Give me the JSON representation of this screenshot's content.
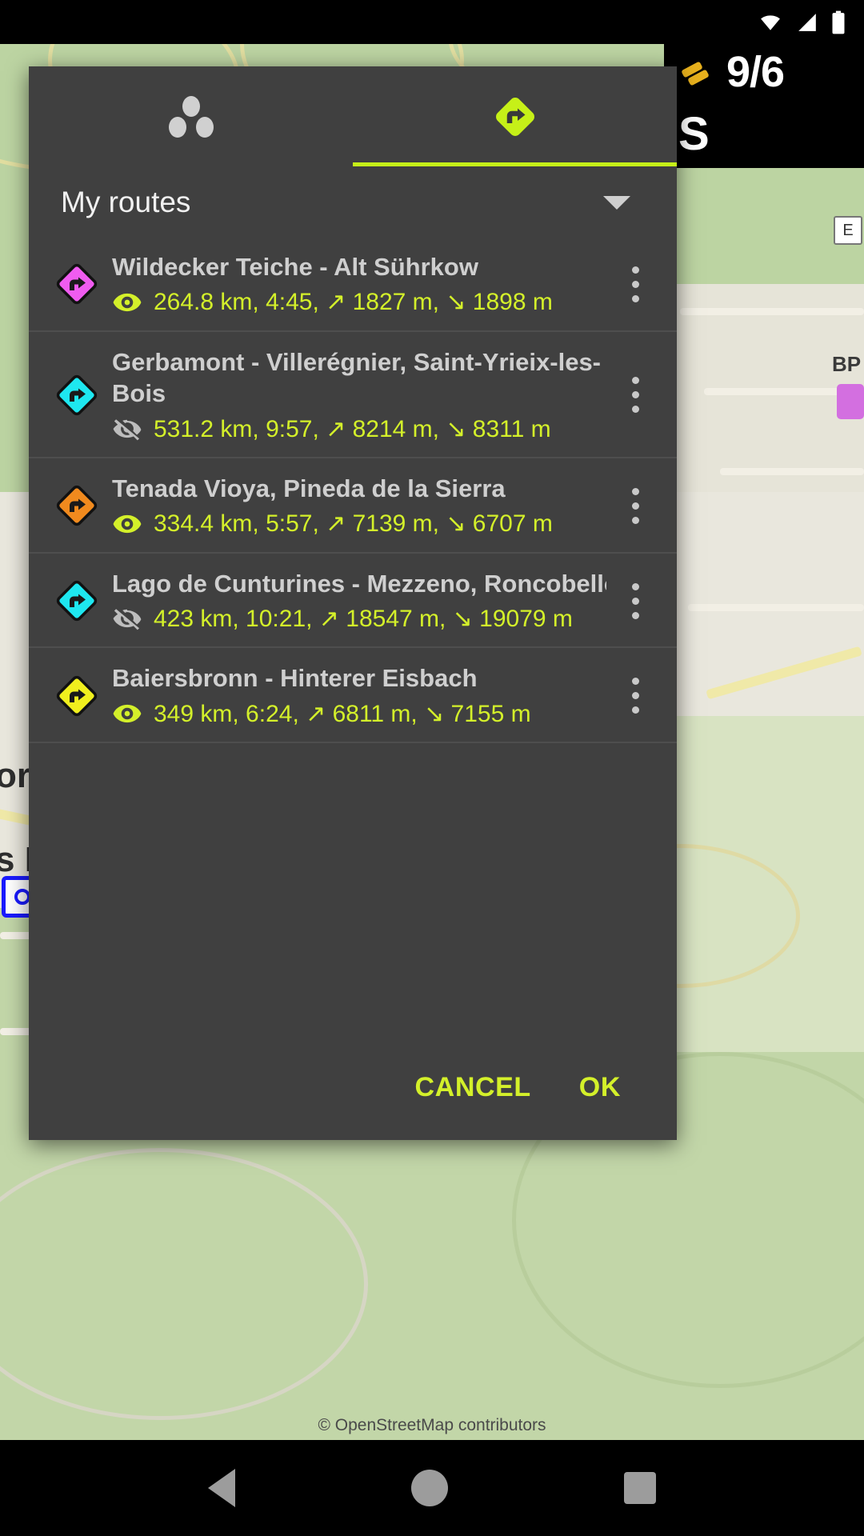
{
  "statusbar": {
    "icons": [
      "wifi-icon",
      "signal-icon",
      "battery-icon"
    ]
  },
  "map": {
    "attribution": "© OpenStreetMap contributors",
    "hud_counter": "9/6",
    "labels": [
      "S",
      "E",
      "BP",
      "or",
      "s E"
    ]
  },
  "dialog": {
    "tabs": [
      {
        "name": "points-tab",
        "icon": "three-dots-cluster-icon",
        "active": false
      },
      {
        "name": "routes-tab",
        "icon": "route-turn-right-diamond-icon",
        "active": true
      }
    ],
    "accent_color": "#c6f018",
    "section": {
      "title": "My routes",
      "expander_icon": "chevron-down-icon"
    },
    "routes": [
      {
        "name": "Wildecker Teiche - Alt Sührkow",
        "marker_color": "#f05cf0",
        "visible": true,
        "visibility_icon": "eye-icon",
        "stats": "264.8 km, 4:45, ↗ 1827 m, ↘ 1898 m",
        "distance": "264.8 km",
        "duration": "4:45",
        "ascent": "1827 m",
        "descent": "1898 m",
        "menu_icon": "kebab-menu-icon"
      },
      {
        "name": "Gerbamont - Villerégnier, Saint-Yrieix-les-Bois",
        "marker_color": "#1ee7f0",
        "visible": false,
        "visibility_icon": "eye-off-icon",
        "stats": "531.2 km, 9:57, ↗ 8214 m, ↘ 8311 m",
        "distance": "531.2 km",
        "duration": "9:57",
        "ascent": "8214 m",
        "descent": "8311 m",
        "menu_icon": "kebab-menu-icon"
      },
      {
        "name": "Tenada Vioya, Pineda de la Sierra",
        "marker_color": "#f08a1e",
        "visible": true,
        "visibility_icon": "eye-icon",
        "stats": "334.4 km, 5:57, ↗ 7139 m, ↘ 6707 m",
        "distance": "334.4 km",
        "duration": "5:57",
        "ascent": "7139 m",
        "descent": "6707 m",
        "menu_icon": "kebab-menu-icon"
      },
      {
        "name": "Lago de Cunturines - Mezzeno, Roncobello",
        "marker_color": "#1ee7f0",
        "visible": false,
        "visibility_icon": "eye-off-icon",
        "stats": "423 km, 10:21, ↗ 18547 m, ↘ 19079 m",
        "distance": "423 km",
        "duration": "10:21",
        "ascent": "18547 m",
        "descent": "19079 m",
        "menu_icon": "kebab-menu-icon"
      },
      {
        "name": "Baiersbronn - Hinterer Eisbach",
        "marker_color": "#f0ef1e",
        "visible": true,
        "visibility_icon": "eye-icon",
        "stats": "349 km, 6:24, ↗ 6811 m, ↘ 7155 m",
        "distance": "349 km",
        "duration": "6:24",
        "ascent": "6811 m",
        "descent": "7155 m",
        "menu_icon": "kebab-menu-icon"
      }
    ],
    "actions": {
      "cancel_label": "CANCEL",
      "ok_label": "OK"
    }
  },
  "navbar": {
    "back_icon": "triangle-back-icon",
    "home_icon": "circle-home-icon",
    "recents_icon": "square-recents-icon"
  }
}
